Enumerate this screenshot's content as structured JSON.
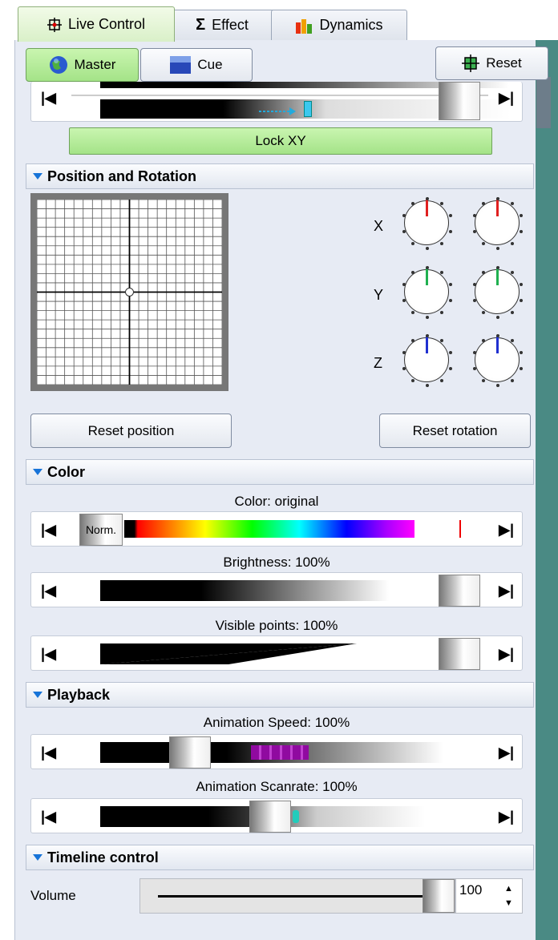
{
  "tabs": [
    {
      "label": "Live Control"
    },
    {
      "label": "Effect"
    },
    {
      "label": "Dynamics"
    }
  ],
  "toolbar": {
    "master_label": "Master",
    "cue_label": "Cue",
    "reset_label": "Reset"
  },
  "lock_xy": {
    "label": "Lock XY"
  },
  "position_rotation": {
    "title": "Position and Rotation",
    "axes": [
      "X",
      "Y",
      "Z"
    ],
    "reset_position": "Reset position",
    "reset_rotation": "Reset rotation",
    "dial_colors": {
      "x": "#e02020",
      "y": "#20b050",
      "z": "#2030d0"
    }
  },
  "color": {
    "title": "Color",
    "color_label": "Color: original",
    "norm_label": "Norm.",
    "brightness_label": "Brightness: 100%",
    "visible_points_label": "Visible points: 100%"
  },
  "playback": {
    "title": "Playback",
    "speed_label": "Animation Speed: 100%",
    "scanrate_label": "Animation Scanrate: 100%"
  },
  "timeline": {
    "title": "Timeline control",
    "volume_label": "Volume",
    "volume_value": "100"
  },
  "arrows": {
    "first": "|◀",
    "last": "▶|"
  }
}
